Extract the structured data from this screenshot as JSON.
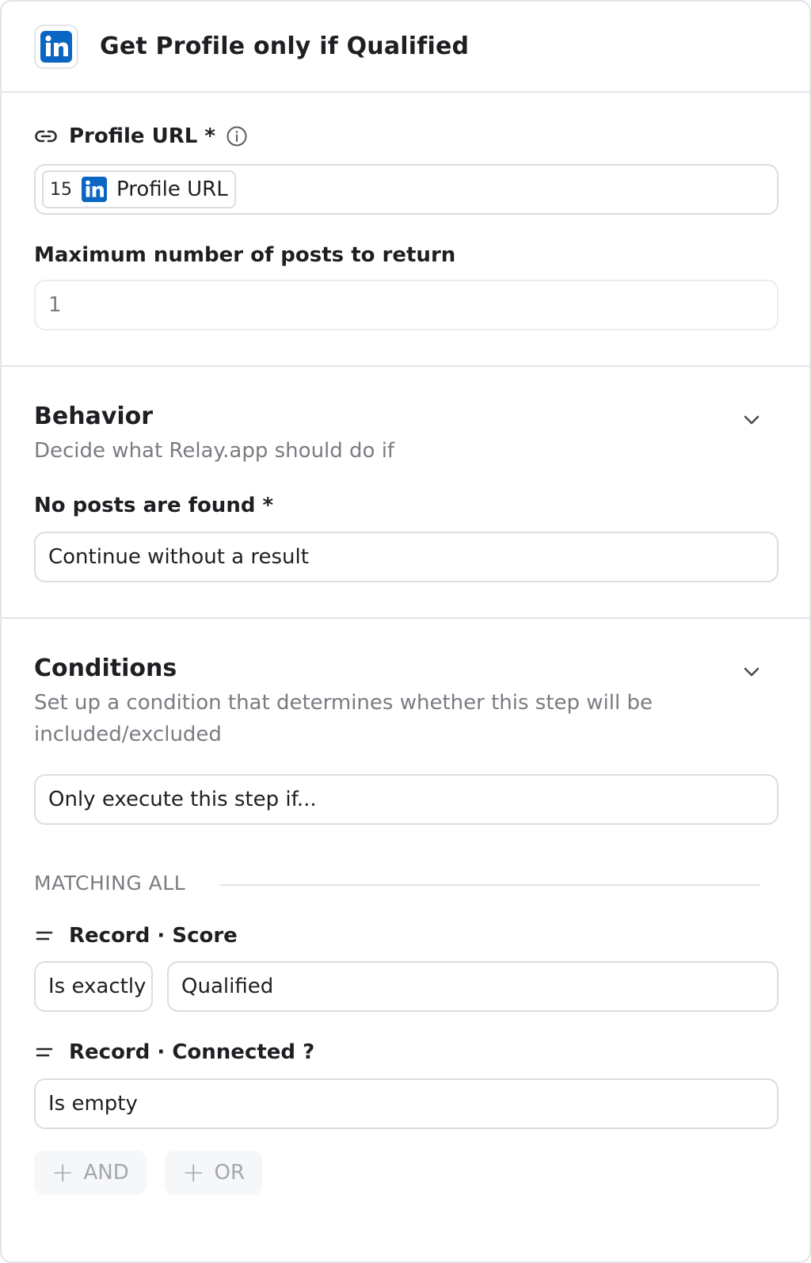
{
  "header": {
    "title": "Get Profile only if Qualified",
    "app_icon": "linkedin-icon"
  },
  "profile_url": {
    "label": "Profile URL *",
    "token": {
      "step_number": "15",
      "icon": "linkedin-icon",
      "label": "Profile URL"
    }
  },
  "max_posts": {
    "label": "Maximum number of posts to return",
    "placeholder": "1"
  },
  "behavior": {
    "title": "Behavior",
    "description": "Decide what Relay.app should do if",
    "no_posts_label": "No posts are found *",
    "no_posts_value": "Continue without a result"
  },
  "conditions": {
    "title": "Conditions",
    "description": "Set up a condition that determines whether this step will be included/excluded",
    "execute_value": "Only execute this step if...",
    "matching_label": "MATCHING ALL",
    "rules": [
      {
        "field": "Record · Score",
        "operator": "Is exactly",
        "value": "Qualified"
      },
      {
        "field": "Record · Connected ?",
        "operator": "Is empty"
      }
    ],
    "and_label": "AND",
    "or_label": "OR"
  },
  "colors": {
    "linkedin": "#0a66c2",
    "border": "#dcdde2",
    "muted_text": "#7a7c82"
  }
}
